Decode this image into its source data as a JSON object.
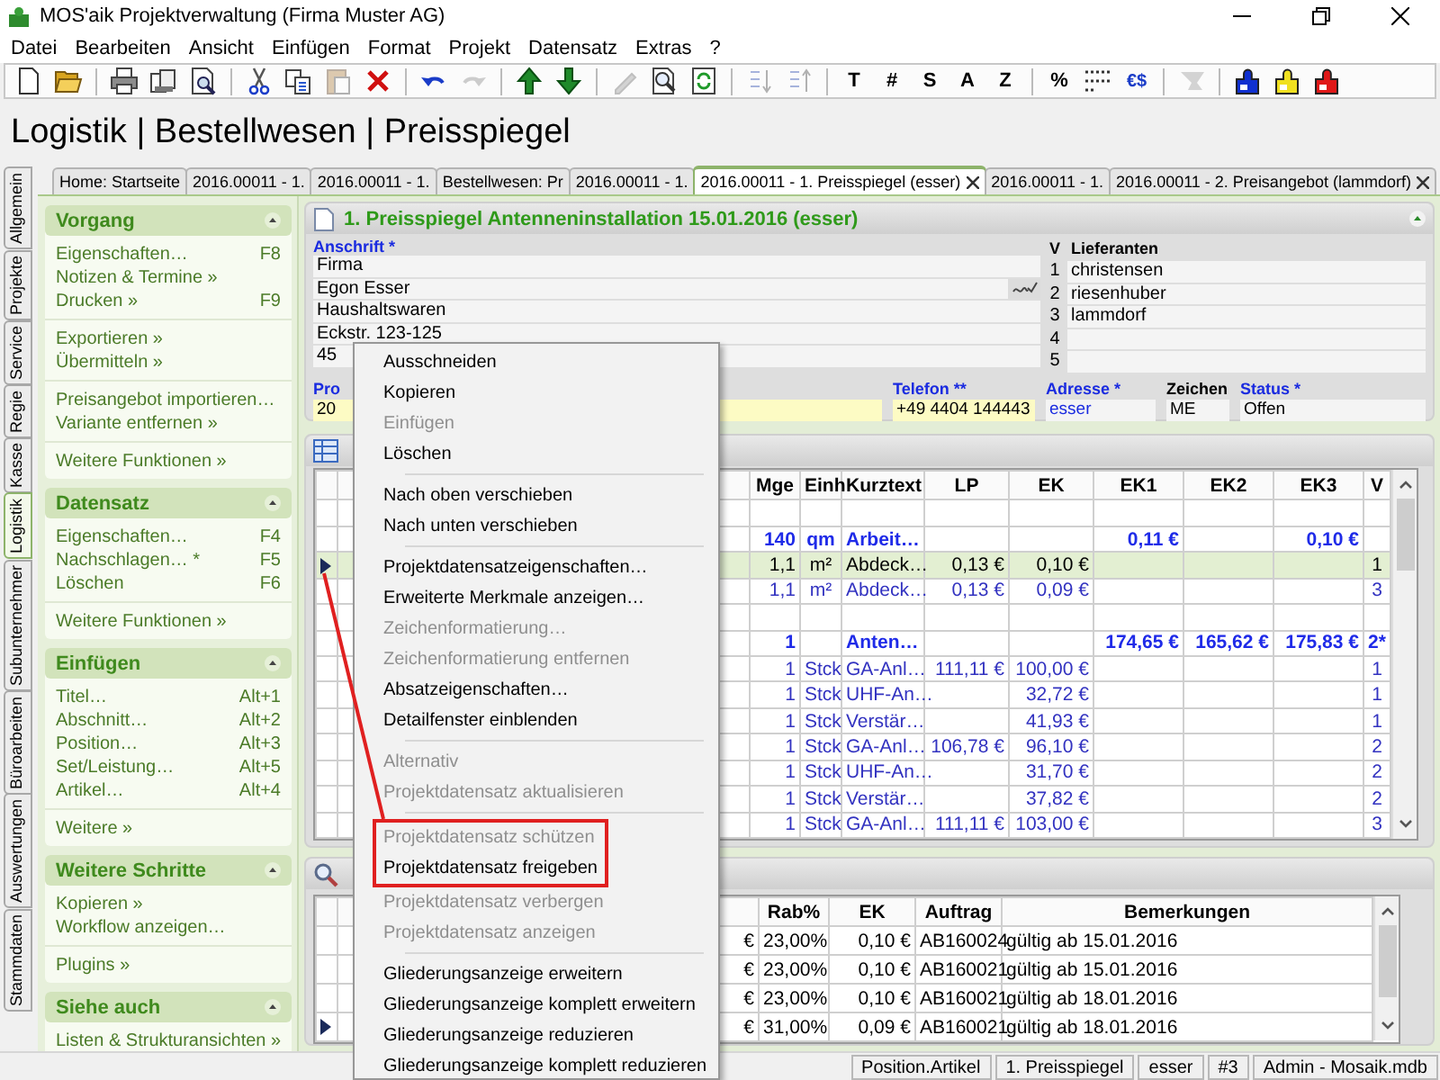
{
  "window": {
    "title": "MOS'aik Projektverwaltung (Firma Muster AG)"
  },
  "menu": [
    "Datei",
    "Bearbeiten",
    "Ansicht",
    "Einfügen",
    "Format",
    "Projekt",
    "Datensatz",
    "Extras",
    "?"
  ],
  "toolbar": [
    {
      "kind": "icon",
      "disabled": false
    },
    {
      "kind": "icon",
      "disabled": false
    },
    {
      "kind": "separator"
    },
    {
      "kind": "icon",
      "disabled": false
    },
    {
      "kind": "icon",
      "disabled": false
    },
    {
      "kind": "icon",
      "disabled": false
    },
    {
      "kind": "separator"
    },
    {
      "kind": "icon",
      "disabled": false
    },
    {
      "kind": "icon",
      "disabled": false
    },
    {
      "kind": "icon",
      "disabled": true
    },
    {
      "kind": "icon",
      "disabled": false
    },
    {
      "kind": "separator"
    },
    {
      "kind": "icon",
      "disabled": false
    },
    {
      "kind": "icon",
      "disabled": true
    },
    {
      "kind": "separator"
    },
    {
      "kind": "icon",
      "disabled": false
    },
    {
      "kind": "icon",
      "disabled": false
    },
    {
      "kind": "separator"
    },
    {
      "kind": "icon",
      "disabled": true
    },
    {
      "kind": "icon",
      "disabled": false
    },
    {
      "kind": "icon",
      "disabled": false
    },
    {
      "kind": "separator"
    },
    {
      "kind": "icon",
      "disabled": true
    },
    {
      "kind": "icon",
      "disabled": true
    },
    {
      "kind": "separator"
    },
    {
      "kind": "glyph",
      "text": "T",
      "disabled": false
    },
    {
      "kind": "glyph",
      "text": "#",
      "disabled": false
    },
    {
      "kind": "glyph",
      "text": "S",
      "disabled": false
    },
    {
      "kind": "glyph",
      "text": "A",
      "disabled": false
    },
    {
      "kind": "glyph",
      "text": "Z",
      "disabled": false
    },
    {
      "kind": "separator"
    },
    {
      "kind": "glyph",
      "text": "%",
      "disabled": false
    },
    {
      "kind": "icon",
      "disabled": false
    },
    {
      "kind": "glyph",
      "text": "€$",
      "disabled": false
    },
    {
      "kind": "separator"
    },
    {
      "kind": "icon",
      "disabled": true
    },
    {
      "kind": "separator"
    },
    {
      "kind": "icon",
      "disabled": false,
      "color": "#1030d0"
    },
    {
      "kind": "icon",
      "disabled": false,
      "color": "#f0e020"
    },
    {
      "kind": "icon",
      "disabled": false,
      "color": "#e01818"
    }
  ],
  "breadcrumb": "Logistik | Bestellwesen | Preisspiegel",
  "side_tabs": [
    {
      "label": "Allgemein",
      "selected": false
    },
    {
      "label": "Projekte",
      "selected": false
    },
    {
      "label": "Service",
      "selected": false
    },
    {
      "label": "Regie",
      "selected": false
    },
    {
      "label": "Kasse",
      "selected": false
    },
    {
      "label": "Logistik",
      "selected": true
    },
    {
      "label": "Subunternehmer",
      "selected": false
    },
    {
      "label": "Büroarbeiten",
      "selected": false
    },
    {
      "label": "Auswertungen",
      "selected": false
    },
    {
      "label": "Stammdaten",
      "selected": false
    }
  ],
  "doc_tabs": [
    {
      "label": "Home: Startseite",
      "selected": false,
      "closable": false
    },
    {
      "label": "2016.00011 - 1.",
      "selected": false,
      "closable": false
    },
    {
      "label": "2016.00011 - 1.",
      "selected": false,
      "closable": false
    },
    {
      "label": "Bestellwesen: Pr",
      "selected": false,
      "closable": false
    },
    {
      "label": "2016.00011 - 1.",
      "selected": false,
      "closable": false
    },
    {
      "label": "2016.00011 - 1. Preisspiegel (esser)",
      "selected": true,
      "closable": true
    },
    {
      "label": "2016.00011 - 1.",
      "selected": false,
      "closable": false
    },
    {
      "label": "2016.00011 - 2. Preisangebot (lammdorf)",
      "selected": false,
      "closable": true
    }
  ],
  "sidebar": [
    {
      "title": "Vorgang",
      "expanded": true,
      "groups": [
        [
          {
            "label": "Eigenschaften…",
            "shortcut": "F8"
          },
          {
            "label": "Notizen & Termine »"
          },
          {
            "label": "Drucken »",
            "shortcut": "F9"
          }
        ],
        [
          {
            "label": "Exportieren »"
          },
          {
            "label": "Übermitteln »"
          }
        ],
        [
          {
            "label": "Preisangebot importieren…"
          },
          {
            "label": "Variante entfernen »"
          }
        ],
        [
          {
            "label": "Weitere Funktionen »"
          }
        ]
      ]
    },
    {
      "title": "Datensatz",
      "expanded": true,
      "groups": [
        [
          {
            "label": "Eigenschaften…",
            "shortcut": "F4"
          },
          {
            "label": "Nachschlagen… *",
            "shortcut": "F5"
          },
          {
            "label": "Löschen",
            "shortcut": "F6"
          }
        ],
        [
          {
            "label": "Weitere Funktionen »"
          }
        ]
      ]
    },
    {
      "title": "Einfügen",
      "expanded": true,
      "groups": [
        [
          {
            "label": "Titel…",
            "shortcut": "Alt+1"
          },
          {
            "label": "Abschnitt…",
            "shortcut": "Alt+2"
          },
          {
            "label": "Position…",
            "shortcut": "Alt+3"
          },
          {
            "label": "Set/Leistung…",
            "shortcut": "Alt+5"
          },
          {
            "label": "Artikel…",
            "shortcut": "Alt+4"
          }
        ],
        [
          {
            "label": "Weitere »"
          }
        ]
      ]
    },
    {
      "title": "Weitere Schritte",
      "expanded": true,
      "groups": [
        [
          {
            "label": "Kopieren »"
          },
          {
            "label": "Workflow anzeigen…"
          }
        ],
        [
          {
            "label": "Plugins »"
          }
        ]
      ]
    },
    {
      "title": "Siehe auch",
      "expanded": true,
      "groups": [
        [
          {
            "label": "Listen & Strukturansichten »"
          }
        ]
      ]
    }
  ],
  "record": {
    "title": "1. Preisspiegel Antenneninstallation 15.01.2016 (esser)",
    "expanded": true,
    "address": {
      "label": "Anschrift *",
      "lines": [
        {
          "text": "Firma",
          "button": false
        },
        {
          "text": "Egon Esser",
          "button": true
        },
        {
          "text": "Haushaltswaren",
          "button": false
        },
        {
          "text": "Eckstr. 123-125",
          "button": false
        },
        {
          "text": "45",
          "button": false
        }
      ]
    },
    "suppliers": {
      "columns": [
        "V",
        "Lieferanten"
      ],
      "rows": [
        {
          "v": "1",
          "name": "christensen"
        },
        {
          "v": "2",
          "name": "riesenhuber"
        },
        {
          "v": "3",
          "name": "lammdorf"
        },
        {
          "v": "4"
        },
        {
          "v": "5"
        }
      ]
    },
    "fields": [
      {
        "label": "Pro",
        "value": "20",
        "required": true,
        "highlighted": true,
        "link": false
      },
      {
        "label": "Telefon **",
        "value": "+49 4404 144443",
        "required": true,
        "highlighted": true,
        "link": false
      },
      {
        "label": "Adresse *",
        "value": "esser",
        "required": true,
        "highlighted": false,
        "link": true
      },
      {
        "label": "Zeichen",
        "value": "ME",
        "required": false,
        "highlighted": false,
        "link": false
      },
      {
        "label": "Status *",
        "value": "Offen",
        "required": true,
        "highlighted": false,
        "link": false
      }
    ]
  },
  "positions": {
    "columns": [
      "Mge",
      "Einh",
      "Kurztext",
      "LP",
      "EK",
      "EK1",
      "EK2",
      "EK3",
      "V"
    ],
    "rows": [
      {
        "kind": "blank",
        "selected": false
      },
      {
        "kind": "group",
        "selected": false,
        "cells": [
          "140",
          "qm",
          "Arbeit…",
          null,
          null,
          "0,11 €",
          null,
          "0,10 €",
          null
        ]
      },
      {
        "kind": "item",
        "selected": true,
        "cells": [
          "1,1",
          "m²",
          "Abdeck…",
          "0,13 €",
          "0,10 €",
          null,
          null,
          null,
          "1"
        ]
      },
      {
        "kind": "item",
        "selected": false,
        "cells": [
          "1,1",
          "m²",
          "Abdeck…",
          "0,13 €",
          "0,09 €",
          null,
          null,
          null,
          "3"
        ]
      },
      {
        "kind": "blank",
        "selected": false
      },
      {
        "kind": "group",
        "selected": false,
        "cells": [
          "1",
          null,
          "Anten…",
          null,
          null,
          "174,65 €",
          "165,62 €",
          "175,83 €",
          "2*"
        ]
      },
      {
        "kind": "item",
        "selected": false,
        "cells": [
          "1",
          "Stck",
          "GA-Anl…",
          "111,11 €",
          "100,00 €",
          null,
          null,
          null,
          "1"
        ]
      },
      {
        "kind": "item",
        "selected": false,
        "cells": [
          "1",
          "Stck",
          "UHF-An…",
          null,
          "32,72 €",
          null,
          null,
          null,
          "1"
        ]
      },
      {
        "kind": "item",
        "selected": false,
        "cells": [
          "1",
          "Stck",
          "Verstär…",
          null,
          "41,93 €",
          null,
          null,
          null,
          "1"
        ]
      },
      {
        "kind": "item",
        "selected": false,
        "cells": [
          "1",
          "Stck",
          "GA-Anl…",
          "106,78 €",
          "96,10 €",
          null,
          null,
          null,
          "2"
        ]
      },
      {
        "kind": "item",
        "selected": false,
        "cells": [
          "1",
          "Stck",
          "UHF-An…",
          null,
          "31,70 €",
          null,
          null,
          null,
          "2"
        ]
      },
      {
        "kind": "item",
        "selected": false,
        "cells": [
          "1",
          "Stck",
          "Verstär…",
          null,
          "37,82 €",
          null,
          null,
          null,
          "2"
        ]
      },
      {
        "kind": "item",
        "selected": false,
        "cells": [
          "1",
          "Stck",
          "GA-Anl…",
          "111,11 €",
          "103,00 €",
          null,
          null,
          null,
          "3"
        ]
      }
    ]
  },
  "details": {
    "columns": [
      "",
      "Rab%",
      "EK",
      "Auftrag",
      "Bemerkungen"
    ],
    "rows": [
      {
        "current": false,
        "cells": [
          "€",
          "23,00%",
          "0,10 €",
          "AB160024",
          "gültig ab 15.01.2016"
        ]
      },
      {
        "current": false,
        "cells": [
          "€",
          "23,00%",
          "0,10 €",
          "AB160021",
          "gültig ab 15.01.2016"
        ]
      },
      {
        "current": false,
        "cells": [
          "€",
          "23,00%",
          "0,10 €",
          "AB160021",
          "gültig ab 18.01.2016"
        ]
      },
      {
        "current": true,
        "cells": [
          "€",
          "31,00%",
          "0,09 €",
          "AB160021",
          "gültig ab 18.01.2016"
        ]
      }
    ]
  },
  "context_menu": [
    {
      "kind": "item",
      "label": "Ausschneiden",
      "disabled": false,
      "marked": false
    },
    {
      "kind": "item",
      "label": "Kopieren",
      "disabled": false,
      "marked": false
    },
    {
      "kind": "item",
      "label": "Einfügen",
      "disabled": true,
      "marked": false
    },
    {
      "kind": "item",
      "label": "Löschen",
      "disabled": false,
      "marked": false
    },
    {
      "kind": "separator"
    },
    {
      "kind": "item",
      "label": "Nach oben verschieben",
      "disabled": false,
      "marked": false
    },
    {
      "kind": "item",
      "label": "Nach unten verschieben",
      "disabled": false,
      "marked": false
    },
    {
      "kind": "separator"
    },
    {
      "kind": "item",
      "label": "Projektdatensatzeigenschaften…",
      "disabled": false,
      "marked": false
    },
    {
      "kind": "item",
      "label": "Erweiterte Merkmale anzeigen…",
      "disabled": false,
      "marked": false
    },
    {
      "kind": "item",
      "label": "Zeichenformatierung…",
      "disabled": true,
      "marked": false
    },
    {
      "kind": "item",
      "label": "Zeichenformatierung entfernen",
      "disabled": true,
      "marked": false
    },
    {
      "kind": "item",
      "label": "Absatzeigenschaften…",
      "disabled": false,
      "marked": false
    },
    {
      "kind": "item",
      "label": "Detailfenster einblenden",
      "disabled": false,
      "marked": false
    },
    {
      "kind": "separator"
    },
    {
      "kind": "item",
      "label": "Alternativ",
      "disabled": true,
      "marked": false
    },
    {
      "kind": "item",
      "label": "Projektdatensatz aktualisieren",
      "disabled": true,
      "marked": false
    },
    {
      "kind": "separator"
    },
    {
      "kind": "item",
      "label": "Projektdatensatz schützen",
      "disabled": true,
      "marked": true
    },
    {
      "kind": "item",
      "label": "Projektdatensatz freigeben",
      "disabled": false,
      "marked": true
    },
    {
      "kind": "item",
      "label": "Projektdatensatz verbergen",
      "disabled": true,
      "marked": false
    },
    {
      "kind": "item",
      "label": "Projektdatensatz anzeigen",
      "disabled": true,
      "marked": false
    },
    {
      "kind": "separator"
    },
    {
      "kind": "item",
      "label": "Gliederungsanzeige erweitern",
      "disabled": false,
      "marked": false
    },
    {
      "kind": "item",
      "label": "Gliederungsanzeige komplett erweitern",
      "disabled": false,
      "marked": false
    },
    {
      "kind": "item",
      "label": "Gliederungsanzeige reduzieren",
      "disabled": false,
      "marked": false
    },
    {
      "kind": "item",
      "label": "Gliederungsanzeige komplett reduzieren",
      "disabled": false,
      "marked": false
    }
  ],
  "status_bar": [
    "Position.Artikel",
    "1. Preisspiegel",
    "esser",
    "#3",
    "Admin - Mosaik.mdb"
  ]
}
